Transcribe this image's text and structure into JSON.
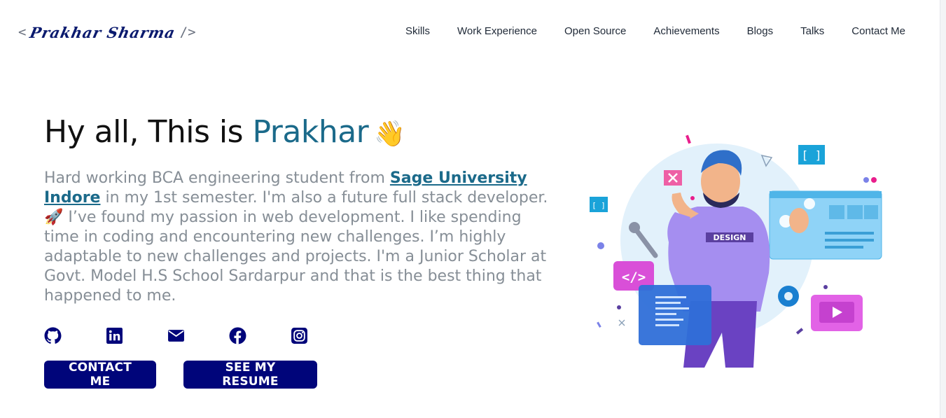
{
  "logo": {
    "open": "< ",
    "name": "Prakhar Sharma",
    "close": " />"
  },
  "nav": {
    "items": [
      {
        "label": "Skills"
      },
      {
        "label": "Work Experience"
      },
      {
        "label": "Open Source"
      },
      {
        "label": "Achievements"
      },
      {
        "label": "Blogs"
      },
      {
        "label": "Talks"
      },
      {
        "label": "Contact Me"
      }
    ]
  },
  "hero": {
    "greeting": "Hy all, This is ",
    "name": "Prakhar",
    "wave": "👋",
    "bio": {
      "part1": "Hard working BCA engineering student from ",
      "link": "Sage University Indore",
      "part2": " in my 1st semester. I'm also a future full stack developer. ",
      "rocket": "🚀",
      "part3": " I’ve found my passion in web development. I like spending time in coding and encountering new challenges. I’m highly adaptable to new challenges and projects. I'm a Junior Scholar at Govt. Model H.S School Sardarpur and that is the best thing that happened to me."
    }
  },
  "socials": [
    {
      "icon": "github-icon"
    },
    {
      "icon": "linkedin-icon"
    },
    {
      "icon": "mail-icon"
    },
    {
      "icon": "facebook-icon"
    },
    {
      "icon": "instagram-icon"
    }
  ],
  "buttons": {
    "contact": "CONTACT ME",
    "resume": "SEE MY RESUME"
  },
  "illustration": {
    "shirt_text": "DESIGN",
    "code_tag": "</>",
    "bracket": "[ ]"
  },
  "colors": {
    "accent": "#1b6a8a",
    "button": "#00057a",
    "text_muted": "#868e96"
  }
}
